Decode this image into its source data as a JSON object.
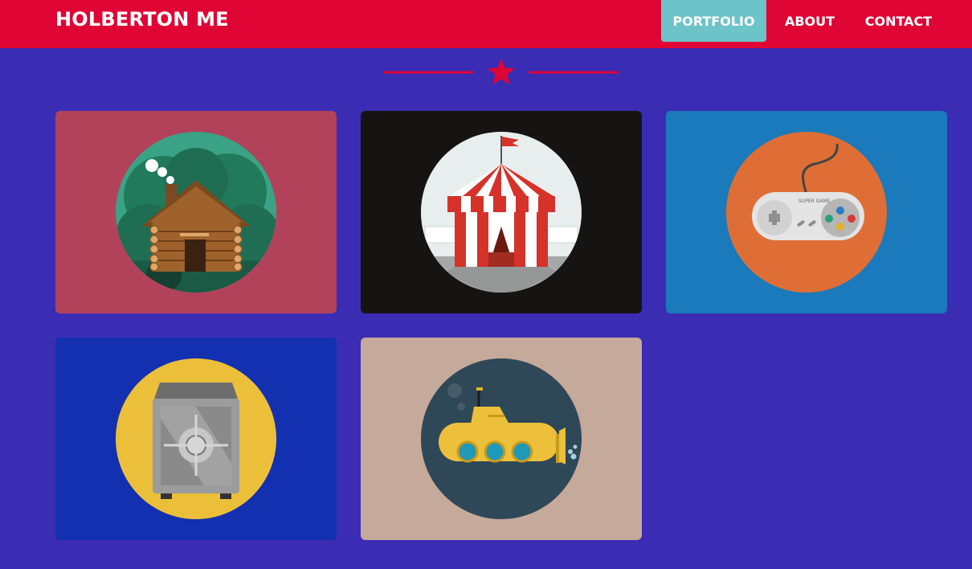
{
  "header": {
    "brand": "HOLBERTON ME",
    "nav": [
      {
        "label": "PORTFOLIO",
        "active": true
      },
      {
        "label": "ABOUT",
        "active": false
      },
      {
        "label": "CONTACT",
        "active": false
      }
    ]
  },
  "colors": {
    "page_background": "#3b2cb4",
    "header_background": "#df0535",
    "active_nav": "#6cc4c8",
    "divider": "#df0535"
  },
  "divider": {
    "icon": "star-icon"
  },
  "portfolio": {
    "items": [
      {
        "icon": "log-cabin-icon",
        "background": "#b2425a",
        "circle": "#2e9c7c"
      },
      {
        "icon": "circus-tent-icon",
        "background": "#161413",
        "circle": "#e8eeee"
      },
      {
        "icon": "game-controller-icon",
        "background": "#1b7abc",
        "circle": "#df6e36"
      },
      {
        "icon": "safe-icon",
        "background": "#1330b0",
        "circle": "#ecbf3a"
      },
      {
        "icon": "submarine-icon",
        "background": "#c5a99a",
        "circle": "#2f4858"
      }
    ]
  }
}
